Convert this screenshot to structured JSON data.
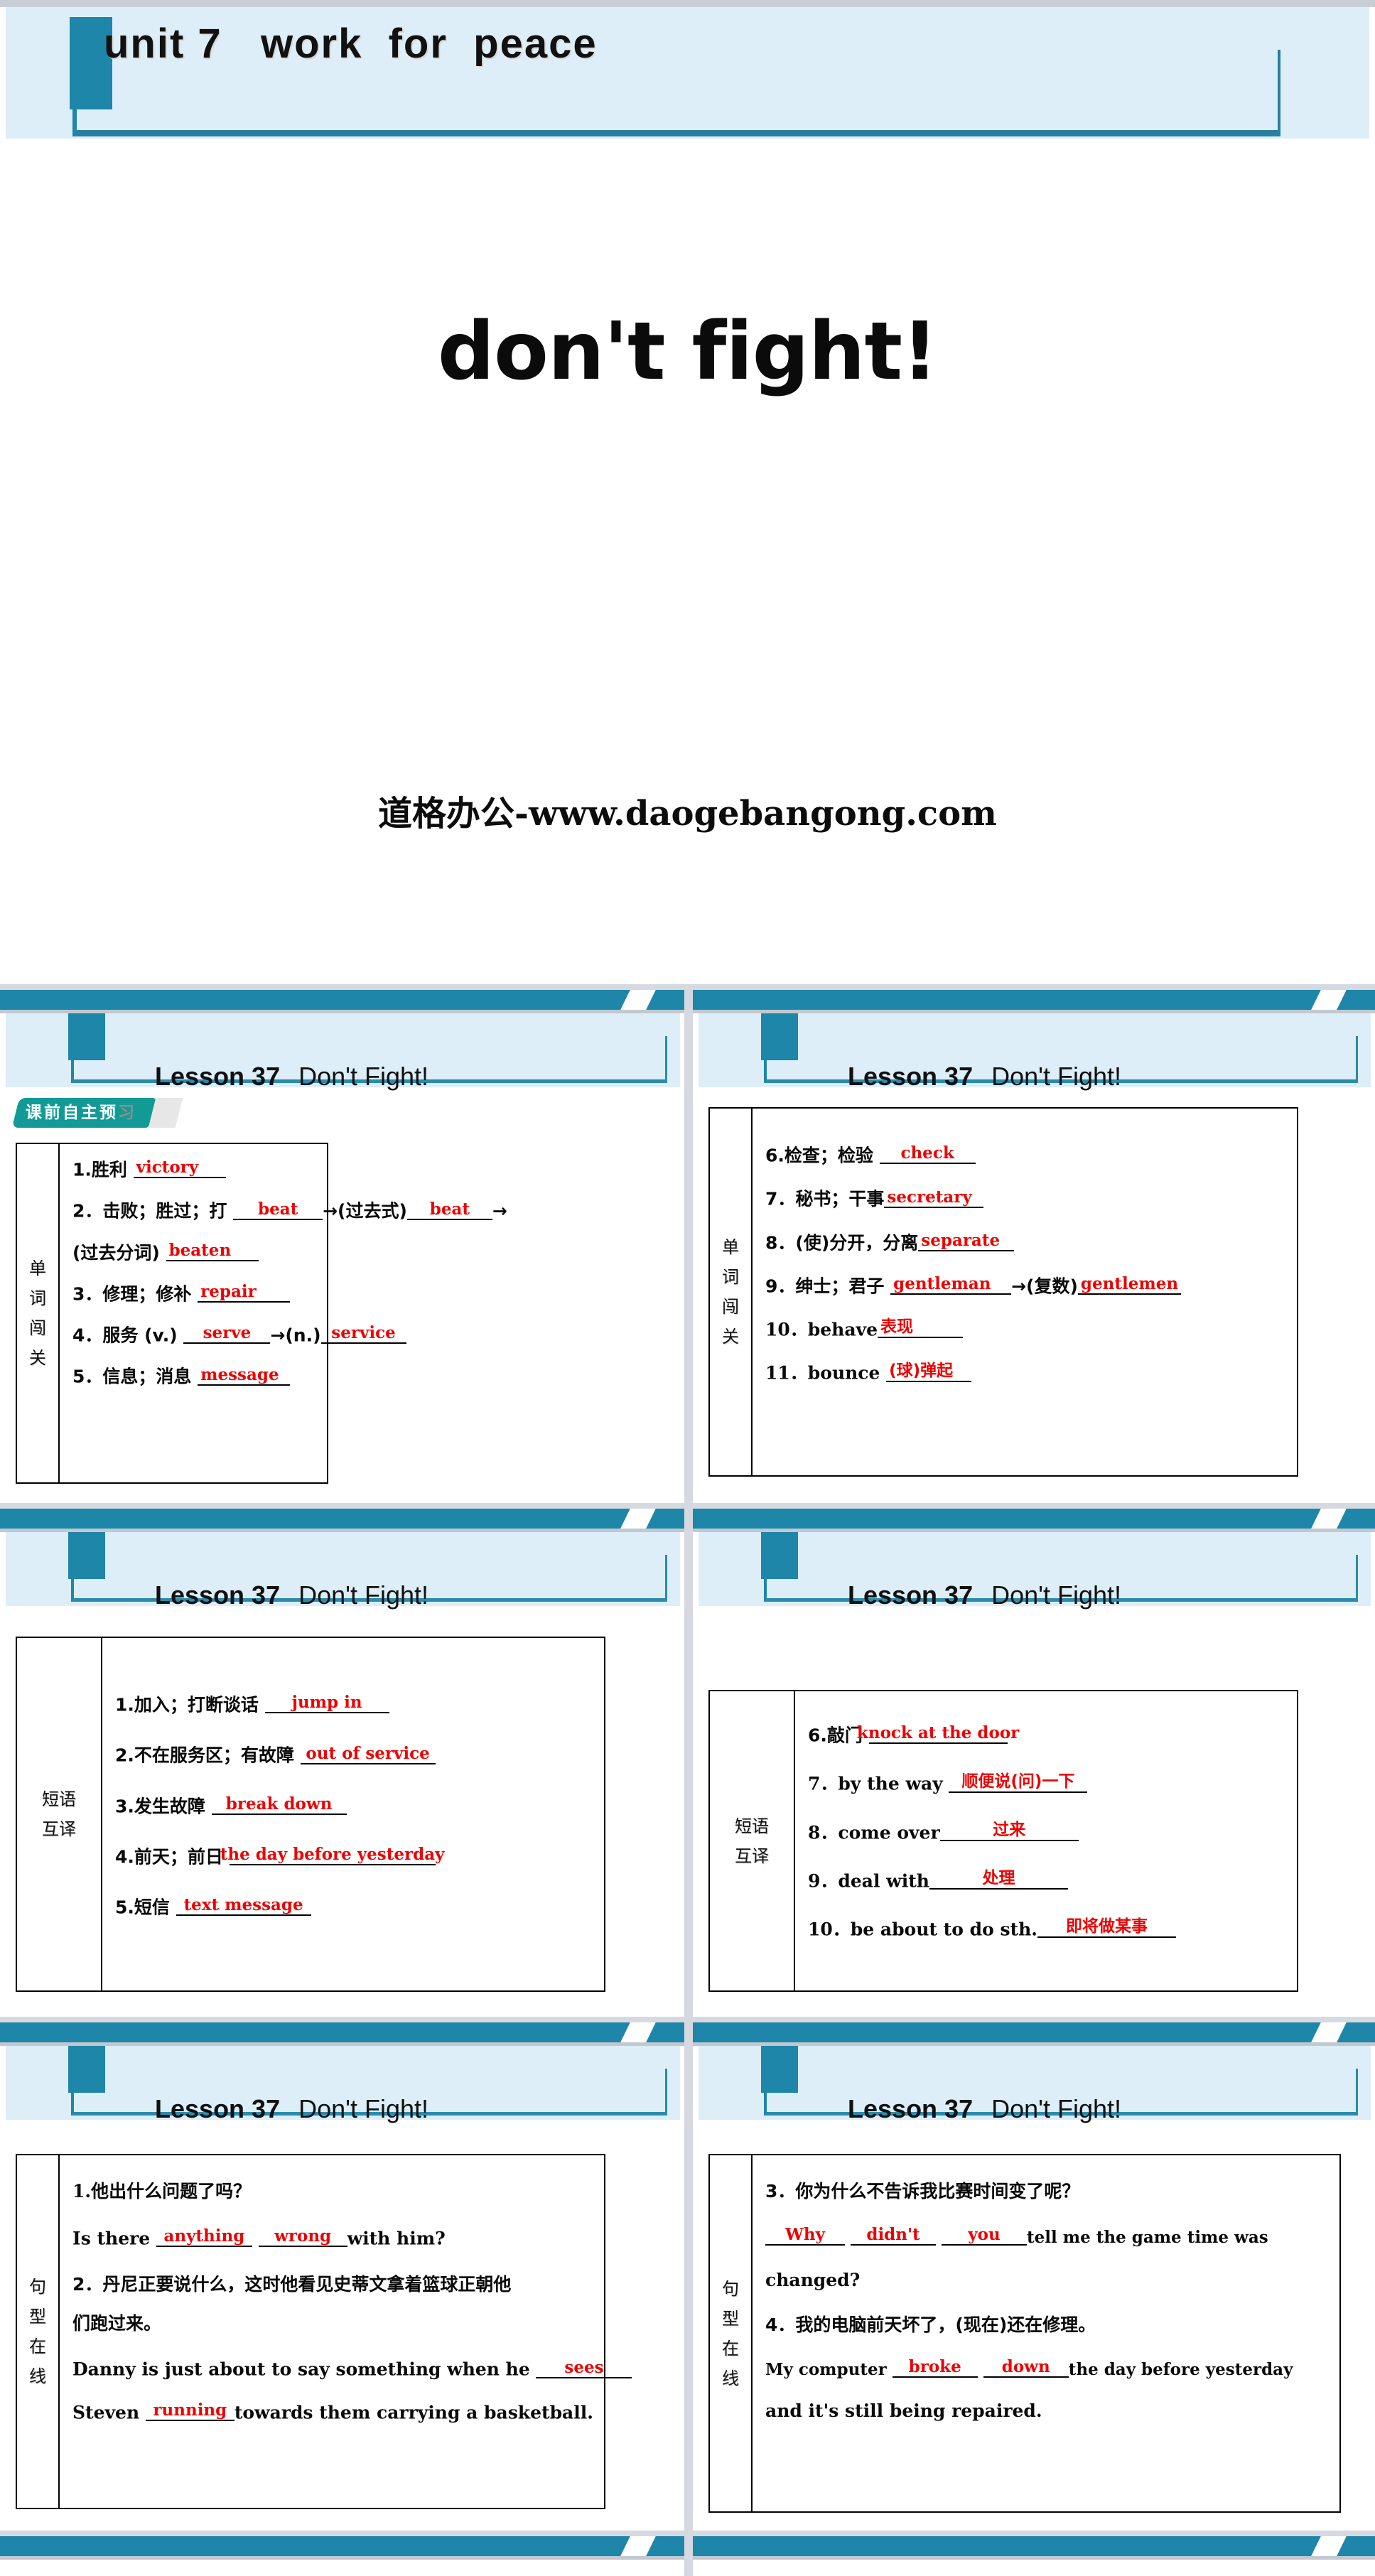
{
  "cover": {
    "unit_title": "unit 7   work  for  peace",
    "main_title": "don't fight!",
    "watermark": "道格办公-www.daogebangong.com"
  },
  "panel_header": {
    "lesson": "Lesson 37",
    "title": "Don't Fight!"
  },
  "badge": {
    "text_bright": "课前自主预",
    "text_faded": "习"
  },
  "panels": [
    {
      "id": "words-1",
      "side_label": "单词闯关",
      "rows": [
        {
          "prefix": "1.胜利 ",
          "answer": "victory",
          "blank_w": 130,
          "suffix": ""
        },
        {
          "prefix": "2．击败；胜过；打 ",
          "answer": "beat",
          "blank_w": 130,
          "mid": "→(过去式)",
          "answer2": "beat",
          "blank2_w": 130,
          "suffix": "→"
        },
        {
          "prefix": "(过去分词) ",
          "answer": "beaten",
          "blank_w": 130,
          "suffix": ""
        },
        {
          "prefix": "3．修理；修补 ",
          "answer": "repair",
          "blank_w": 130,
          "suffix": ""
        },
        {
          "prefix": "4．服务 (v.) ",
          "answer": "serve",
          "blank_w": 130,
          "mid": "→(n.)",
          "answer2": "service",
          "blank2_w": 130,
          "suffix": ""
        },
        {
          "prefix": "5．信息；消息 ",
          "answer": "message",
          "blank_w": 130,
          "suffix": ""
        }
      ]
    },
    {
      "id": "words-2",
      "side_label": "单词闯关",
      "rows": [
        {
          "prefix": "6.检查；检验 ",
          "answer": "check",
          "blank_w": 135,
          "suffix": ""
        },
        {
          "prefix": "7．秘书；干事",
          "answer": "secretary",
          "blank_w": 140,
          "suffix": ""
        },
        {
          "prefix": "8．(使)分开，分离",
          "answer": "separate",
          "blank_w": 135,
          "suffix": ""
        },
        {
          "prefix": "9．绅士；君子 ",
          "answer": "gentleman",
          "blank_w": 170,
          "mid": "→(复数)",
          "answer2": "gentlemen",
          "blank2_w": 145,
          "suffix": ""
        },
        {
          "prefix": "10．behave",
          "answer": "表现",
          "answer_cn": true,
          "blank_w": 120,
          "suffix": ""
        },
        {
          "prefix": "11．bounce ",
          "answer": "(球)弹起",
          "answer_cn": true,
          "blank_w": 120,
          "suffix": ""
        }
      ]
    },
    {
      "id": "phrases-1",
      "side_label": "短语互译",
      "rows": [
        {
          "prefix": "1.加入；打断谈话 ",
          "answer": "jump in",
          "blank_w": 175,
          "suffix": ""
        },
        {
          "prefix": "2.不在服务区；有故障 ",
          "answer": "out of service",
          "blank_w": 190,
          "suffix": ""
        },
        {
          "prefix": "3.发生故障 ",
          "answer": "break down",
          "blank_w": 190,
          "suffix": ""
        },
        {
          "prefix": "4.前天；前日 ",
          "answer": "the day before yesterday",
          "blank_w": 290,
          "suffix": ""
        },
        {
          "prefix": "5.短信 ",
          "answer": "text message",
          "blank_w": 190,
          "suffix": ""
        }
      ]
    },
    {
      "id": "phrases-2",
      "side_label": "短语互译",
      "rows": [
        {
          "prefix": "6.敲门 ",
          "answer": "knock at the door",
          "answer_cn": false,
          "blank_w": 195,
          "suffix": ""
        },
        {
          "prefix": "7．by the way ",
          "answer": "顺便说(问)一下",
          "answer_cn": true,
          "blank_w": 195,
          "suffix": ""
        },
        {
          "prefix": "8．come over",
          "answer": "过来",
          "answer_cn": true,
          "blank_w": 195,
          "suffix": ""
        },
        {
          "prefix": "9．deal with",
          "answer": "处理",
          "answer_cn": true,
          "blank_w": 195,
          "suffix": ""
        },
        {
          "prefix": "10．be about to do sth.",
          "answer": "即将做某事",
          "answer_cn": true,
          "blank_w": 195,
          "suffix": ""
        }
      ]
    },
    {
      "id": "sentences-1",
      "side_label": "句型在线",
      "lines": [
        {
          "type": "cn",
          "text": "1.他出什么问题了吗？"
        },
        {
          "type": "mix",
          "prefix": "Is there ",
          "a1": "anything",
          "w1": 135,
          "gap": " ",
          "a2": "wrong",
          "w2": 125,
          "suffix": "with him?"
        },
        {
          "type": "cn",
          "text": "2．丹尼正要说什么，这时他看见史蒂文拿着篮球正朝他"
        },
        {
          "type": "cn",
          "text": "们跑过来。"
        },
        {
          "type": "mix",
          "prefix": "Danny is just about to say something when he ",
          "a1": "sees",
          "w1": 135,
          "suffix": ""
        },
        {
          "type": "mix",
          "prefix": "Steven ",
          "a1": "running",
          "w1": 125,
          "suffix": "towards them carrying a basketball."
        }
      ]
    },
    {
      "id": "sentences-2",
      "side_label": "句型在线",
      "lines": [
        {
          "type": "cn",
          "text": "3．你为什么不告诉我比赛时间变了呢？"
        },
        {
          "type": "mix3",
          "prefix": " ",
          "a1": "Why",
          "w1": 130,
          "a2": "didn't",
          "w2": 140,
          "a3": "you",
          "w3": 140,
          "suffix": "tell me the game time was"
        },
        {
          "type": "en",
          "text": "changed?"
        },
        {
          "type": "cn",
          "text": "4．我的电脑前天坏了，(现在)还在修理。"
        },
        {
          "type": "mix",
          "prefix": "My computer ",
          "a1": "broke",
          "w1": 130,
          "gap": " ",
          "a2": "down",
          "w2": 130,
          "suffix": "the day before yesterday"
        },
        {
          "type": "en",
          "text": "and it's still being repaired."
        }
      ]
    }
  ],
  "colors": {
    "teal": "#1e86a8",
    "light_blue": "#ddeef8",
    "badge_teal": "#129b96",
    "answer_red": "#ee0000"
  }
}
